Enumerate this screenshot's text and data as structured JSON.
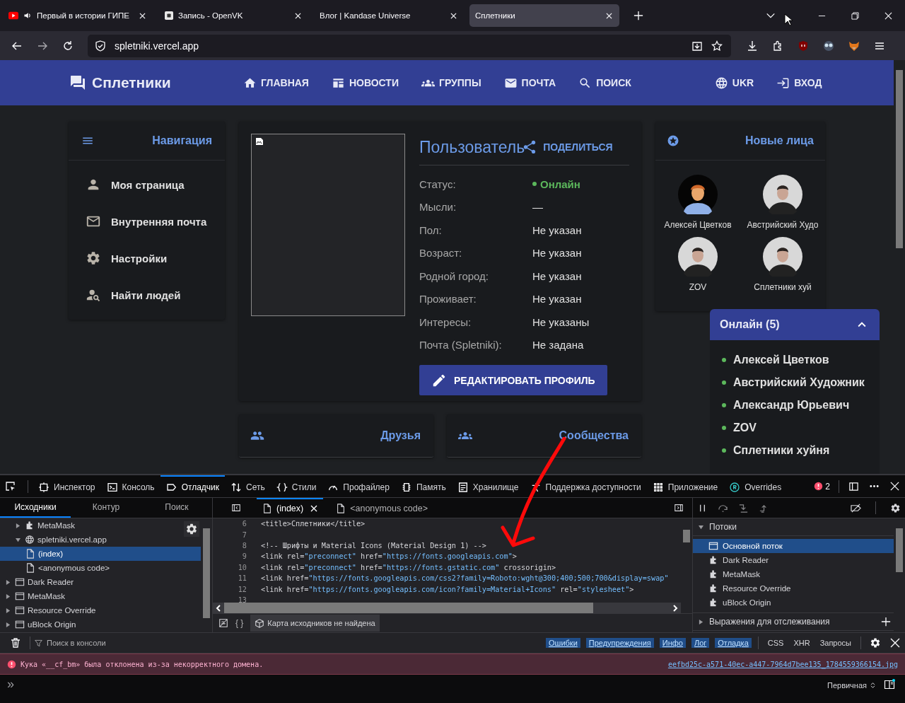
{
  "browser": {
    "tabs": [
      {
        "title": "Первый в истории ГИПЕ",
        "selected": false,
        "kind": "video",
        "playing_audio": true
      },
      {
        "title": "Запись - OpenVK",
        "selected": false,
        "kind": "square",
        "playing_audio": false
      },
      {
        "title": "Влог | Kandase Universe",
        "selected": false,
        "kind": "plain",
        "playing_audio": false
      },
      {
        "title": "Сплетники",
        "selected": true,
        "kind": "plain",
        "playing_audio": false
      }
    ],
    "address": "spletniki.vercel.app"
  },
  "site": {
    "logo": "Сплетники",
    "nav": [
      {
        "label": "ГЛАВНАЯ",
        "kind": "home"
      },
      {
        "label": "НОВОСТИ",
        "kind": "news"
      },
      {
        "label": "ГРУППЫ",
        "kind": "groups"
      },
      {
        "label": "ПОЧТА",
        "kind": "mail"
      },
      {
        "label": "ПОИСК",
        "kind": "search"
      }
    ],
    "nav_right": [
      {
        "label": "UKR",
        "kind": "globe"
      },
      {
        "label": "ВХОД",
        "kind": "login"
      }
    ],
    "navigation": {
      "title": "Навигация",
      "items": [
        {
          "label": "Моя страница",
          "kind": "person"
        },
        {
          "label": "Внутренняя почта",
          "kind": "mail"
        },
        {
          "label": "Настройки",
          "kind": "gear"
        },
        {
          "label": "Найти людей",
          "kind": "person_search"
        }
      ]
    },
    "profile": {
      "title": "Пользователь",
      "share": "ПОДЕЛИТЬСЯ",
      "fields": [
        {
          "label": "Статус:",
          "value": "Онлайн",
          "kind": "online"
        },
        {
          "label": "Мысли:",
          "value": "—",
          "kind": "text"
        },
        {
          "label": "Пол:",
          "value": "Не указан",
          "kind": "text"
        },
        {
          "label": "Возраст:",
          "value": "Не указан",
          "kind": "text"
        },
        {
          "label": "Родной город:",
          "value": "Не указан",
          "kind": "text"
        },
        {
          "label": "Проживает:",
          "value": "Не указан",
          "kind": "text"
        },
        {
          "label": "Интересы:",
          "value": "Не указаны",
          "kind": "text"
        },
        {
          "label": "Почта (Spletniki):",
          "value": "Не задана",
          "kind": "text"
        }
      ],
      "edit_button": "РЕДАКТИРОВАТЬ ПРОФИЛЬ"
    },
    "new_faces": {
      "title": "Новые лица",
      "people": [
        {
          "name": "Алексей Цветков",
          "kind": "default"
        },
        {
          "name": "Австрийский Худо",
          "kind": "photo"
        },
        {
          "name": "ZOV",
          "kind": "photo"
        },
        {
          "name": "Сплетники хуй",
          "kind": "photo"
        }
      ]
    },
    "online": {
      "title": "Онлайн (5)",
      "expanded": true,
      "users": [
        "Алексей Цветков",
        "Австрийский Художник",
        "Александр Юрьевич",
        "ZOV",
        "Сплетники хуйня"
      ]
    },
    "bottom_cards": [
      {
        "title": "Друзья",
        "kind": "friends"
      },
      {
        "title": "Сообщества",
        "kind": "groups"
      }
    ]
  },
  "devtools": {
    "tools": [
      {
        "label": "Инспектор",
        "kind": "inspector",
        "selected": false
      },
      {
        "label": "Консоль",
        "kind": "console",
        "selected": false
      },
      {
        "label": "Отладчик",
        "kind": "debugger",
        "selected": true
      },
      {
        "label": "Сеть",
        "kind": "network",
        "selected": false
      },
      {
        "label": "Стили",
        "kind": "styles",
        "selected": false
      },
      {
        "label": "Профайлер",
        "kind": "profiler",
        "selected": false
      },
      {
        "label": "Память",
        "kind": "memory",
        "selected": false
      },
      {
        "label": "Хранилище",
        "kind": "storage",
        "selected": false
      },
      {
        "label": "Поддержка доступности",
        "kind": "accessibility",
        "selected": false
      },
      {
        "label": "Приложение",
        "kind": "application",
        "selected": false
      },
      {
        "label": "Overrides",
        "kind": "overrides",
        "selected": false
      }
    ],
    "error_count": "2",
    "source_tabs": [
      {
        "label": "Исходники",
        "selected": true
      },
      {
        "label": "Контур",
        "selected": false
      },
      {
        "label": "Поиск",
        "selected": false
      }
    ],
    "tree": [
      {
        "kind": "hidden",
        "children": [
          {
            "label": "MetaMask",
            "kind": "extension",
            "expanded": false,
            "selected": false
          },
          {
            "label": "spletniki.vercel.app",
            "kind": "domain",
            "expanded": true,
            "selected": false,
            "children": [
              {
                "label": "(index)",
                "kind": "file",
                "selected": true
              },
              {
                "label": "<anonymous code>",
                "kind": "file",
                "selected": false
              }
            ]
          }
        ]
      },
      {
        "label": "Dark Reader",
        "kind": "window",
        "expanded": false,
        "selected": false
      },
      {
        "label": "MetaMask",
        "kind": "window",
        "expanded": false,
        "selected": false
      },
      {
        "label": "Resource Override",
        "kind": "window",
        "expanded": false,
        "selected": false
      },
      {
        "label": "uBlock Origin",
        "kind": "window",
        "expanded": false,
        "selected": false
      }
    ],
    "editor_tabs": [
      {
        "label": "(index)",
        "selected": true
      },
      {
        "label": "<anonymous code>",
        "selected": false
      }
    ],
    "code": [
      {
        "line": "6",
        "text": "<title>Сплетники</title>"
      },
      {
        "line": "7"
      },
      {
        "line": "8",
        "text": "<!-- Шрифты и Material Icons (Material Design 1) -->"
      },
      {
        "line": "9",
        "text": "<link rel=\"preconnect\" href=\"https://fonts.googleapis.com\">"
      },
      {
        "line": "10",
        "text": "<link rel=\"preconnect\" href=\"https://fonts.gstatic.com\" crossorigin>"
      },
      {
        "line": "11",
        "text": "<link href=\"https://fonts.googleapis.com/css2?family=Roboto:wght@300;400;500;700&display=swap\""
      },
      {
        "line": "12",
        "text": "<link href=\"https://fonts.googleapis.com/icon?family=Material+Icons\" rel=\"stylesheet\">"
      },
      {
        "line": "13"
      }
    ],
    "editor_footer": {
      "braces": "{ }",
      "source_map": "Карта исходников не найдена"
    },
    "threads": {
      "title": "Потоки",
      "expanded": true,
      "items": [
        {
          "label": "Основной поток",
          "kind": "window",
          "selected": true
        },
        {
          "label": "Dark Reader",
          "kind": "extension",
          "selected": false
        },
        {
          "label": "MetaMask",
          "kind": "extension",
          "selected": false
        },
        {
          "label": "Resource Override",
          "kind": "extension",
          "selected": false
        },
        {
          "label": "uBlock Origin",
          "kind": "extension",
          "selected": false
        }
      ]
    },
    "watch": {
      "title": "Выражения для отслеживания",
      "expanded": false
    },
    "console": {
      "filter_placeholder": "Поиск в консоли",
      "levels": [
        {
          "label": "Ошибки",
          "selected": true
        },
        {
          "label": "Предупреждения",
          "selected": true
        },
        {
          "label": "Инфо",
          "selected": true
        },
        {
          "label": "Лог",
          "selected": true
        },
        {
          "label": "Отладка",
          "selected": true
        }
      ],
      "types": [
        {
          "label": "CSS",
          "selected": false
        },
        {
          "label": "XHR",
          "selected": false
        },
        {
          "label": "Запросы",
          "selected": false
        }
      ],
      "messages": [
        {
          "kind": "error",
          "text": "Кука «__cf_bm» была отклонена из-за некорректного домена.",
          "source": "eefbd25c-a571-40ec-a447-7964d7bee135_1784559366154.jpg"
        }
      ],
      "prompt": "»",
      "context": "Первичная"
    }
  }
}
